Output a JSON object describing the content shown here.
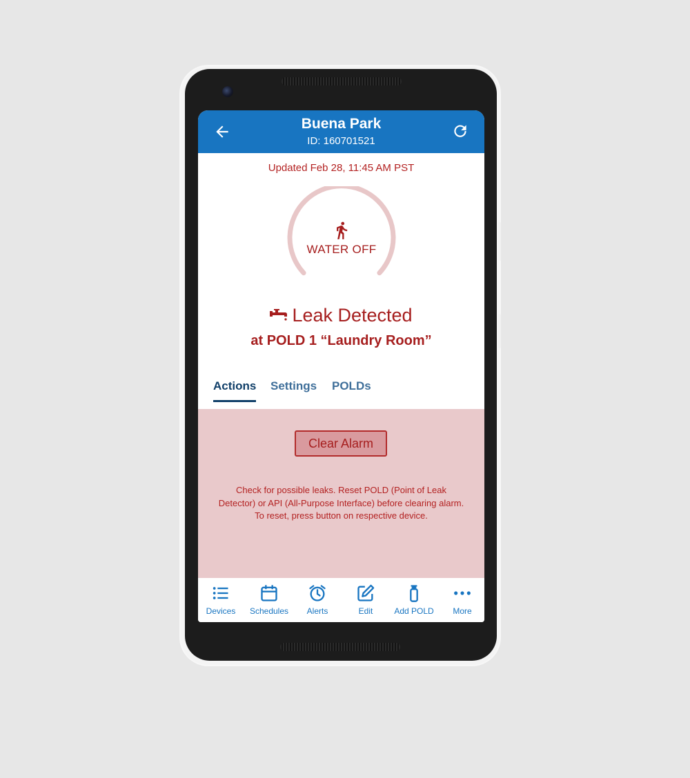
{
  "header": {
    "title": "Buena Park",
    "subtitle": "ID: 160701521",
    "back_icon": "arrow-left-icon",
    "refresh_icon": "refresh-icon"
  },
  "status": {
    "updated": "Updated Feb 28, 11:45 AM PST",
    "gauge_label": "WATER OFF",
    "gauge_icon": "running-person-icon",
    "alert_title": "Leak Detected",
    "alert_icon": "faucet-icon",
    "alert_location": "at POLD 1 “Laundry Room”"
  },
  "tabs": [
    {
      "label": "Actions",
      "active": true
    },
    {
      "label": "Settings",
      "active": false
    },
    {
      "label": "POLDs",
      "active": false
    }
  ],
  "alarm": {
    "button_label": "Clear Alarm",
    "message_line1": "Check for possible leaks. Reset POLD (Point of Leak",
    "message_line2": "Detector) or API (All-Purpose Interface) before clearing alarm.",
    "message_line3": "To reset, press button on respective device."
  },
  "bottom_nav": [
    {
      "label": "Devices",
      "icon": "list-icon"
    },
    {
      "label": "Schedules",
      "icon": "calendar-icon"
    },
    {
      "label": "Alerts",
      "icon": "alarm-clock-icon"
    },
    {
      "label": "Edit",
      "icon": "edit-icon"
    },
    {
      "label": "Add POLD",
      "icon": "sensor-icon"
    },
    {
      "label": "More",
      "icon": "more-dots-icon"
    }
  ],
  "colors": {
    "header_blue": "#1875c1",
    "alert_red": "#a61e1e",
    "alarm_panel": "#e9c9cb",
    "gauge_ring": "#e8c7c8"
  }
}
